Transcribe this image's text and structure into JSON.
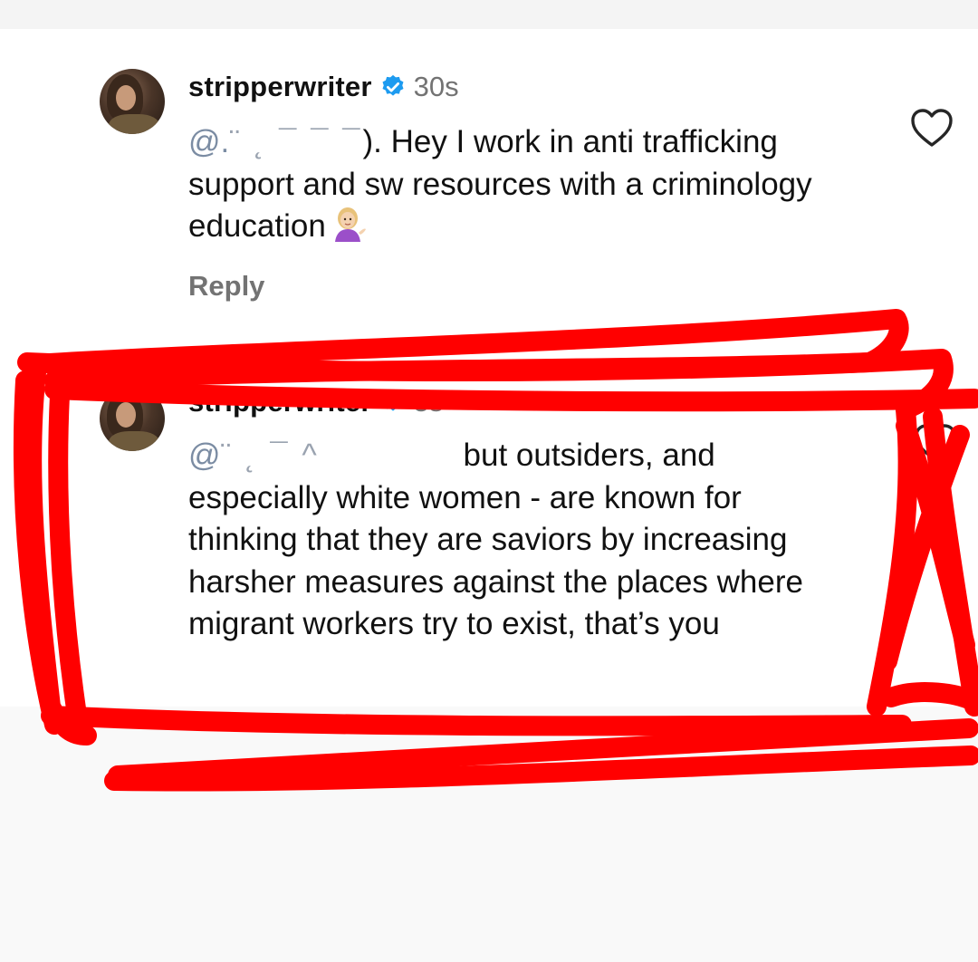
{
  "comments": [
    {
      "username": "stripperwriter",
      "time": "30s",
      "mention": "@.",
      "redacted": "  ¨ ˛ ¯ ¯ ¯ ",
      "text_rest": "). Hey I work in anti trafficking support and sw resources with a criminology education",
      "emoji": "woman-tipping-hand-emoji",
      "reply_label": "Reply"
    },
    {
      "username": "stripperwriter",
      "time": "5s",
      "mention": "@",
      "redacted": " ¨ ˛ ¯ ^ ",
      "text_rest": "but outsiders, and especially white women - are known for thinking that they are saviors by increasing harsher measures against the places where migrant workers try to exist, that’s you"
    }
  ],
  "colors": {
    "annotation_red": "#ff0000",
    "verified_blue": "#1d9bf0",
    "muted_gray": "#737373"
  },
  "icons": [
    "verified-badge-icon",
    "heart-icon",
    "woman-tipping-hand-emoji"
  ]
}
